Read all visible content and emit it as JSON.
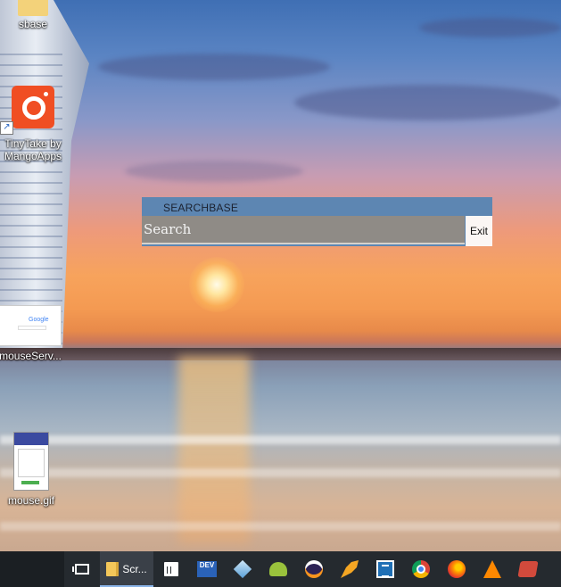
{
  "desktop": {
    "icons": [
      {
        "label": "sbase",
        "icon": "folder-icon"
      },
      {
        "label": "TinyTake by MangoApps",
        "icon": "tinytake-icon"
      },
      {
        "label": "mouseServ...",
        "icon": "google-thumbnail-icon"
      },
      {
        "label": "mouse.gif",
        "icon": "gif-thumbnail-icon"
      }
    ]
  },
  "search_window": {
    "title": "SEARCHBASE",
    "search_placeholder": "Search",
    "search_value": "",
    "exit_label": "Exit"
  },
  "taskbar": {
    "items": [
      {
        "icon": "task-view-icon",
        "label": ""
      },
      {
        "icon": "file-explorer-icon",
        "label": "Scr..."
      },
      {
        "icon": "store-icon",
        "label": ""
      },
      {
        "icon": "dev-cpp-icon",
        "label": "DEV"
      },
      {
        "icon": "virtualbox-icon",
        "label": ""
      },
      {
        "icon": "android-studio-icon",
        "label": ""
      },
      {
        "icon": "eclipse-icon",
        "label": ""
      },
      {
        "icon": "tool-icon",
        "label": ""
      },
      {
        "icon": "brackets-icon",
        "label": ""
      },
      {
        "icon": "chrome-icon",
        "label": ""
      },
      {
        "icon": "firefox-icon",
        "label": ""
      },
      {
        "icon": "vlc-icon",
        "label": ""
      },
      {
        "icon": "misc-app-icon",
        "label": ""
      }
    ]
  },
  "colors": {
    "window_title_bar": "#5d86b2",
    "search_field": "#8f8b86",
    "taskbar": "#252a2f",
    "tinytake_brand": "#f04e23"
  }
}
